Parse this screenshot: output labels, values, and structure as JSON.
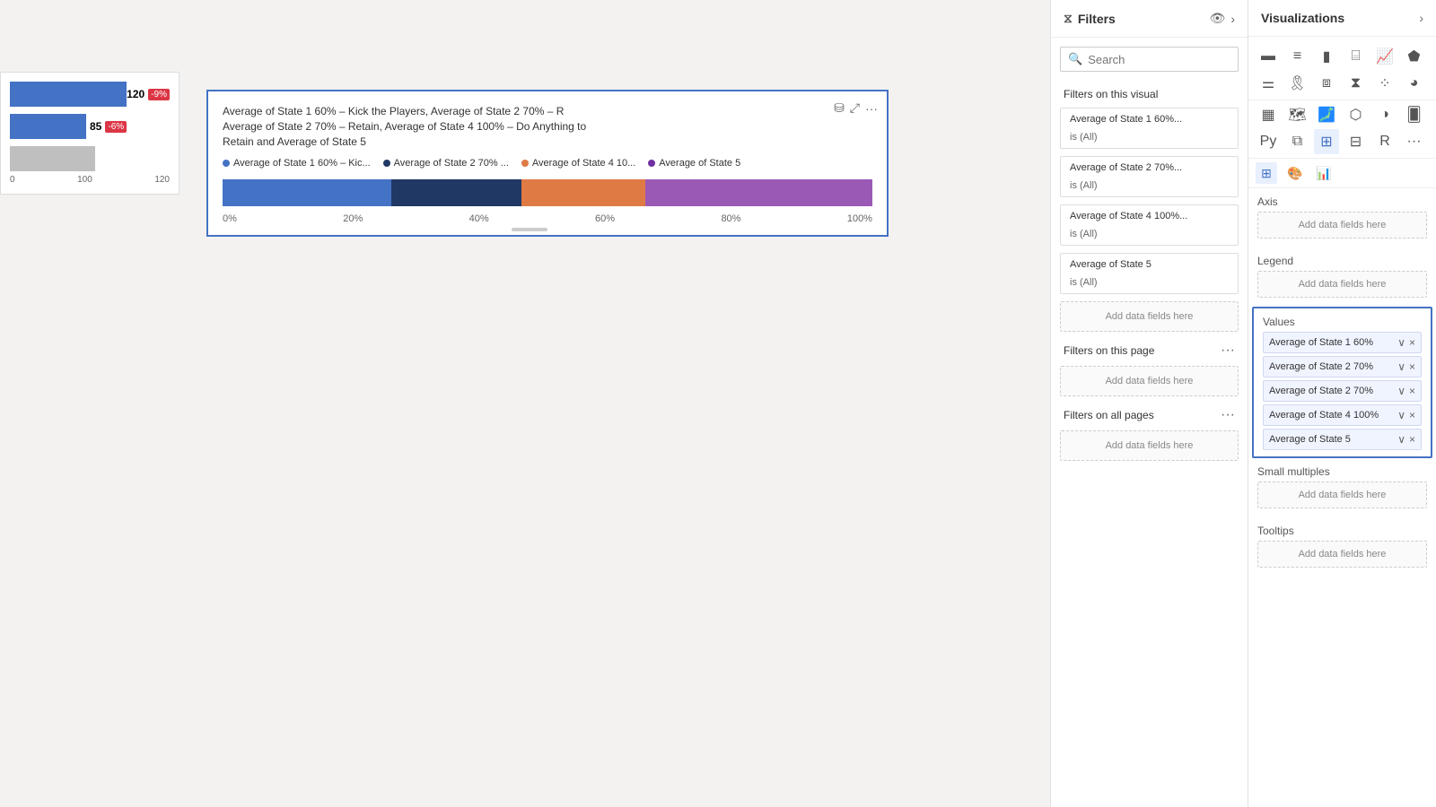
{
  "canvas": {
    "left_chart": {
      "bar1_value": "120",
      "bar1_badge": "-9%",
      "bar2_value": "85",
      "bar2_badge": "-6%",
      "x_labels": [
        "0",
        "100",
        "120"
      ]
    }
  },
  "main_chart": {
    "title_line1": "Average of State 1 60% – Kick the Players, Average of State 2 70% – R",
    "title_line2": "Average of State 2 70% – Retain, Average of State 4 100% – Do Anything to",
    "title_line3": "Retain and Average of State 5",
    "legend": [
      {
        "label": "Average of State 1 60% – Kic...",
        "color": "#4472c4"
      },
      {
        "label": "Average of State 2 70% ...",
        "color": "#203864"
      },
      {
        "label": "Average of State 4 10...",
        "color": "#e07a45"
      },
      {
        "label": "Average of State 5",
        "color": "#7030a0"
      }
    ],
    "bar_segments": [
      {
        "color": "#4472c4",
        "width": "26%"
      },
      {
        "color": "#203864",
        "width": "20%"
      },
      {
        "color": "#e07a45",
        "width": "19%"
      },
      {
        "color": "#9b59b6",
        "width": "35%"
      }
    ],
    "axis_labels": [
      "0%",
      "20%",
      "40%",
      "60%",
      "80%",
      "100%"
    ]
  },
  "filters": {
    "title": "Filters",
    "search_placeholder": "Search",
    "filters_on_visual_label": "Filters on this visual",
    "visual_filters": [
      {
        "name": "Average of State 1 60%...",
        "condition": "is (All)"
      },
      {
        "name": "Average of State 2 70%...",
        "condition": "is (All)"
      },
      {
        "name": "Average of State 4 100%...",
        "condition": "is (All)"
      },
      {
        "name": "Average of State 5",
        "condition": "is (All)"
      }
    ],
    "add_data_visual": "Add data fields here",
    "filters_on_page_label": "Filters on this page",
    "add_data_page": "Add data fields here",
    "filters_on_all_label": "Filters on all pages",
    "add_data_all": "Add data fields here"
  },
  "visualizations": {
    "title": "Visualizations",
    "axis_label": "Axis",
    "axis_add": "Add data fields here",
    "legend_label": "Legend",
    "legend_add": "Add data fields here",
    "values_label": "Values",
    "values": [
      "Average of State 1 60%",
      "Average of State 2 70%",
      "Average of State 2 70%",
      "Average of State 4 100%",
      "Average of State 5"
    ],
    "small_multiples_label": "Small multiples",
    "small_multiples_add": "Add data fields here",
    "tooltips_label": "Tooltips",
    "tooltips_add": "Add data fields here"
  }
}
